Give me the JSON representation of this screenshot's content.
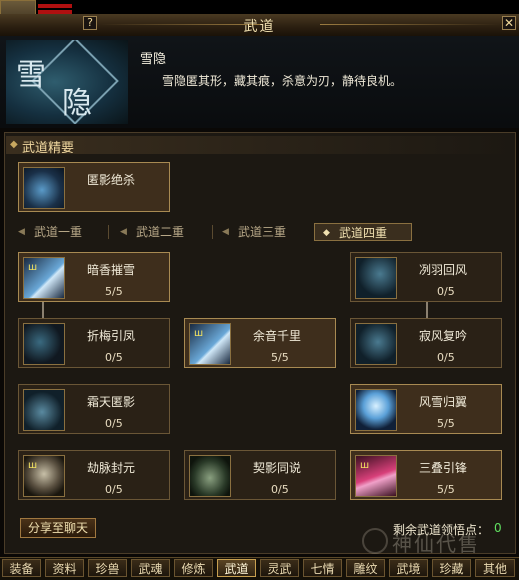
{
  "window": {
    "title": "武道",
    "help_label": "?",
    "close_label": "✕"
  },
  "skill": {
    "emblem_char1": "雪",
    "emblem_char2": "隐",
    "name": "雪隐",
    "description": "雪隐匿其形，藏其痕，杀意为刃，静待良机。"
  },
  "section": {
    "title": "武道精要"
  },
  "essence": {
    "name": "匿影绝杀",
    "icon": "shadow-strike-icon"
  },
  "tabs": [
    {
      "label": "武道一重",
      "active": false
    },
    {
      "label": "武道二重",
      "active": false
    },
    {
      "label": "武道三重",
      "active": false
    },
    {
      "label": "武道四重",
      "active": true
    }
  ],
  "talents": [
    {
      "name": "暗香摧雪",
      "count": "5/5",
      "icon": "sword-slash-icon",
      "lit": true
    },
    {
      "name": "冽羽回风",
      "count": "0/5",
      "icon": "wind-feather-icon",
      "lit": false
    },
    {
      "name": "折梅引凤",
      "count": "0/5",
      "icon": "plum-phoenix-icon",
      "lit": false
    },
    {
      "name": "余音千里",
      "count": "5/5",
      "icon": "sword-echo-icon",
      "lit": true
    },
    {
      "name": "寂风复吟",
      "count": "0/5",
      "icon": "silent-wind-icon",
      "lit": false
    },
    {
      "name": "霜天匿影",
      "count": "0/5",
      "icon": "frost-shadow-icon",
      "lit": false
    },
    {
      "name": "风雪归翼",
      "count": "5/5",
      "icon": "snow-wing-icon",
      "lit": true
    },
    {
      "name": "劫脉封元",
      "count": "0/5",
      "icon": "seal-pulse-icon",
      "lit": false
    },
    {
      "name": "契影同说",
      "count": "0/5",
      "icon": "shadow-pact-icon",
      "lit": false
    },
    {
      "name": "三叠引锋",
      "count": "5/5",
      "icon": "triple-edge-icon",
      "lit": true
    }
  ],
  "share_label": "分享至聊天",
  "remaining": {
    "label": "剩余武道领悟点：",
    "value": "0"
  },
  "watermark": "神仙代售",
  "bottom_tabs": [
    {
      "label": "装备",
      "active": false
    },
    {
      "label": "资料",
      "active": false
    },
    {
      "label": "珍兽",
      "active": false
    },
    {
      "label": "武魂",
      "active": false
    },
    {
      "label": "修炼",
      "active": false
    },
    {
      "label": "武道",
      "active": true
    },
    {
      "label": "灵武",
      "active": false
    },
    {
      "label": "七情",
      "active": false
    },
    {
      "label": "雕纹",
      "active": false
    },
    {
      "label": "武境",
      "active": false
    },
    {
      "label": "珍藏",
      "active": false
    },
    {
      "label": "其他",
      "active": false
    }
  ],
  "colors": {
    "accent": "#c8a050",
    "remaining_value": "#60e060",
    "hp_bar": "#b01010"
  }
}
